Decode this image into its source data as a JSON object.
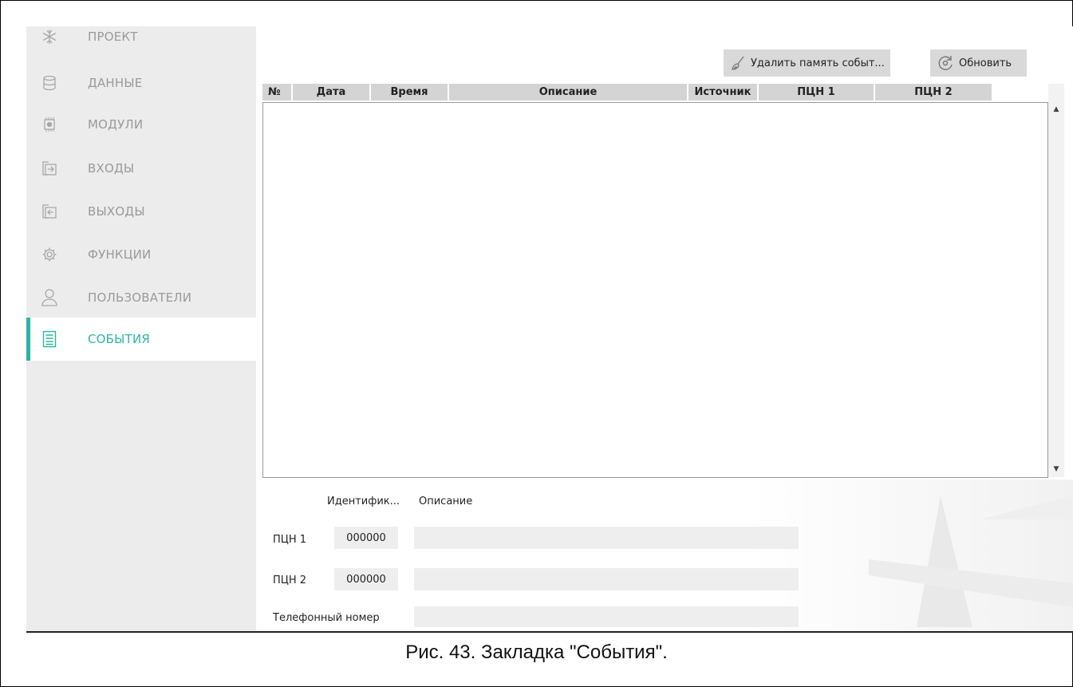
{
  "sidebar": {
    "items": [
      {
        "label": "ПРОЕКТ",
        "icon": "snowflake-icon"
      },
      {
        "label": "ДАННЫЕ",
        "icon": "database-icon"
      },
      {
        "label": "МОДУЛИ",
        "icon": "chip-icon"
      },
      {
        "label": "ВХОДЫ",
        "icon": "input-icon"
      },
      {
        "label": "ВЫХОДЫ",
        "icon": "output-icon"
      },
      {
        "label": "ФУНКЦИИ",
        "icon": "gear-icon"
      },
      {
        "label": "ПОЛЬЗОВАТЕЛИ",
        "icon": "user-icon"
      },
      {
        "label": "СОБЫТИЯ",
        "icon": "document-icon",
        "active": true
      }
    ]
  },
  "toolbar": {
    "delete_label": "Удалить память событ...",
    "refresh_label": "Обновить"
  },
  "table": {
    "columns": [
      "№",
      "Дата",
      "Время",
      "Описание",
      "Источник",
      "ПЦН 1",
      "ПЦН 2"
    ],
    "rows": []
  },
  "details": {
    "id_header": "Идентифик...",
    "desc_header": "Описание",
    "pcn1_label": "ПЦН 1",
    "pcn1_id": "000000",
    "pcn1_desc": "",
    "pcn2_label": "ПЦН 2",
    "pcn2_id": "000000",
    "pcn2_desc": "",
    "phone_label": "Телефонный номер",
    "phone_value": ""
  },
  "caption": "Рис. 43. Закладка \"События\".",
  "colors": {
    "accent": "#2cb5a0",
    "sidebar_bg": "#ececec",
    "header_bg": "#d4d4d4"
  }
}
